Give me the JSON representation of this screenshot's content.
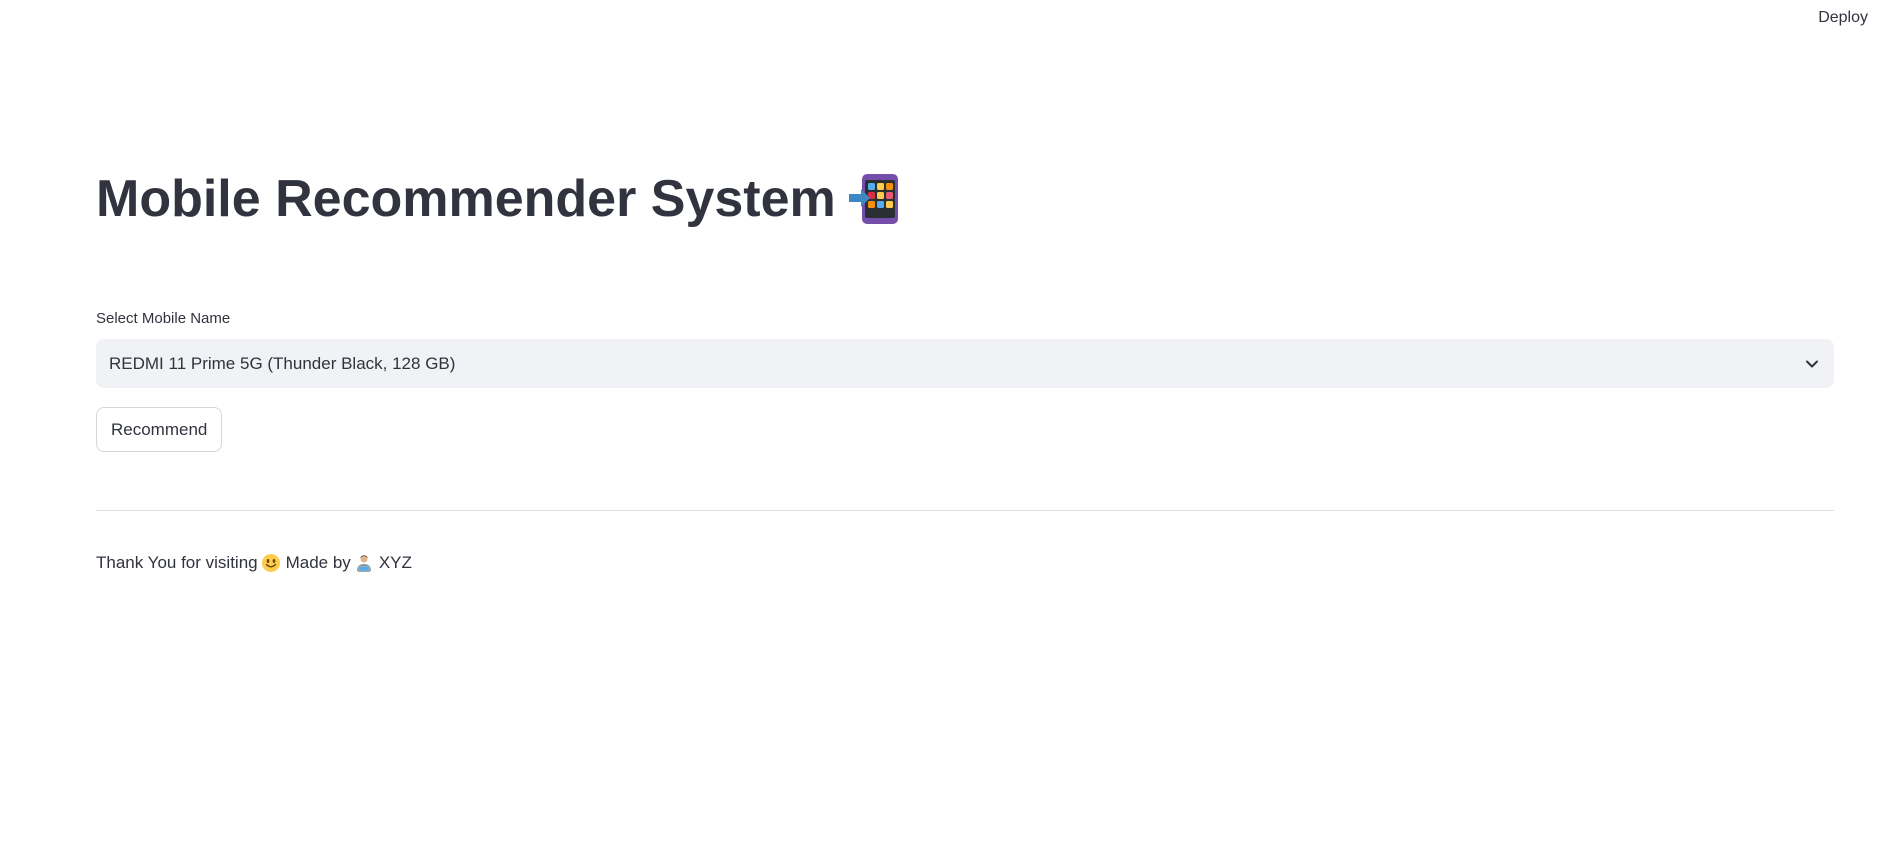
{
  "header": {
    "deploy_label": "Deploy"
  },
  "page": {
    "title": "Mobile Recommender System",
    "title_icon": "mobile-phone-arrow-icon"
  },
  "selector": {
    "label": "Select Mobile Name",
    "selected_value": "REDMI 11 Prime 5G (Thunder Black, 128 GB)",
    "dropdown_icon": "chevron-down-icon"
  },
  "actions": {
    "recommend_label": "Recommend"
  },
  "footer": {
    "thanks_text": "Thank You for visiting",
    "thanks_icon": "smiling-face-icon",
    "made_by_text": "Made by",
    "made_by_icon": "technologist-icon",
    "author": "XYZ"
  },
  "colors": {
    "text": "#31333f",
    "select_bg": "#f0f2f6",
    "border": "#d5d7dd",
    "background": "#ffffff"
  }
}
